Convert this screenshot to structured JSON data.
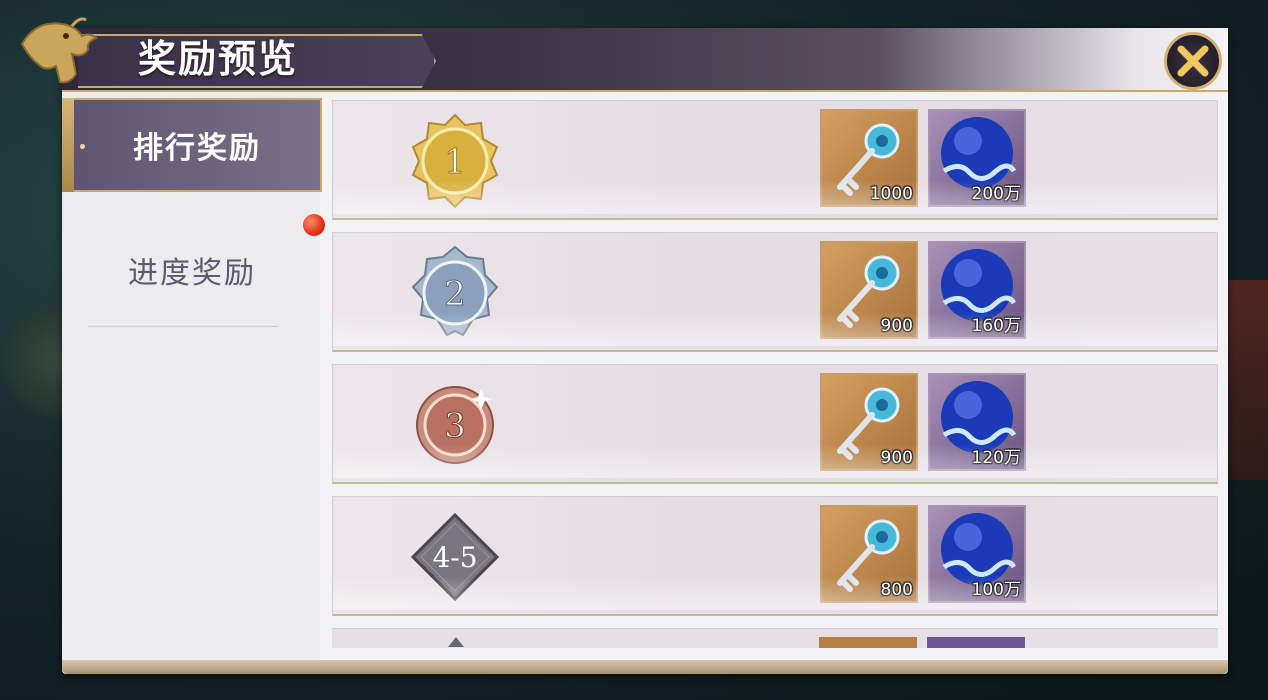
{
  "header": {
    "title": "奖励预览"
  },
  "sidebar": {
    "tabs": [
      {
        "label": "排行奖励",
        "active": true
      },
      {
        "label": "进度奖励",
        "active": false,
        "notification": true
      }
    ]
  },
  "rewards": [
    {
      "rank": "1",
      "badge": "gold-medal",
      "items": [
        {
          "icon": "key-icon",
          "qty": "1000"
        },
        {
          "icon": "blue-orb-icon",
          "qty": "200万"
        }
      ]
    },
    {
      "rank": "2",
      "badge": "silver-medal",
      "items": [
        {
          "icon": "key-icon",
          "qty": "900"
        },
        {
          "icon": "blue-orb-icon",
          "qty": "160万"
        }
      ]
    },
    {
      "rank": "3",
      "badge": "bronze-medal",
      "items": [
        {
          "icon": "key-icon",
          "qty": "900"
        },
        {
          "icon": "blue-orb-icon",
          "qty": "120万"
        }
      ]
    },
    {
      "rank": "4-5",
      "badge": "diamond-badge",
      "items": [
        {
          "icon": "key-icon",
          "qty": "800"
        },
        {
          "icon": "blue-orb-icon",
          "qty": "100万"
        }
      ]
    }
  ],
  "colors": {
    "accent_gold": "#c9a96a",
    "active_tab": "#6a607a",
    "notification": "#e0301a"
  }
}
